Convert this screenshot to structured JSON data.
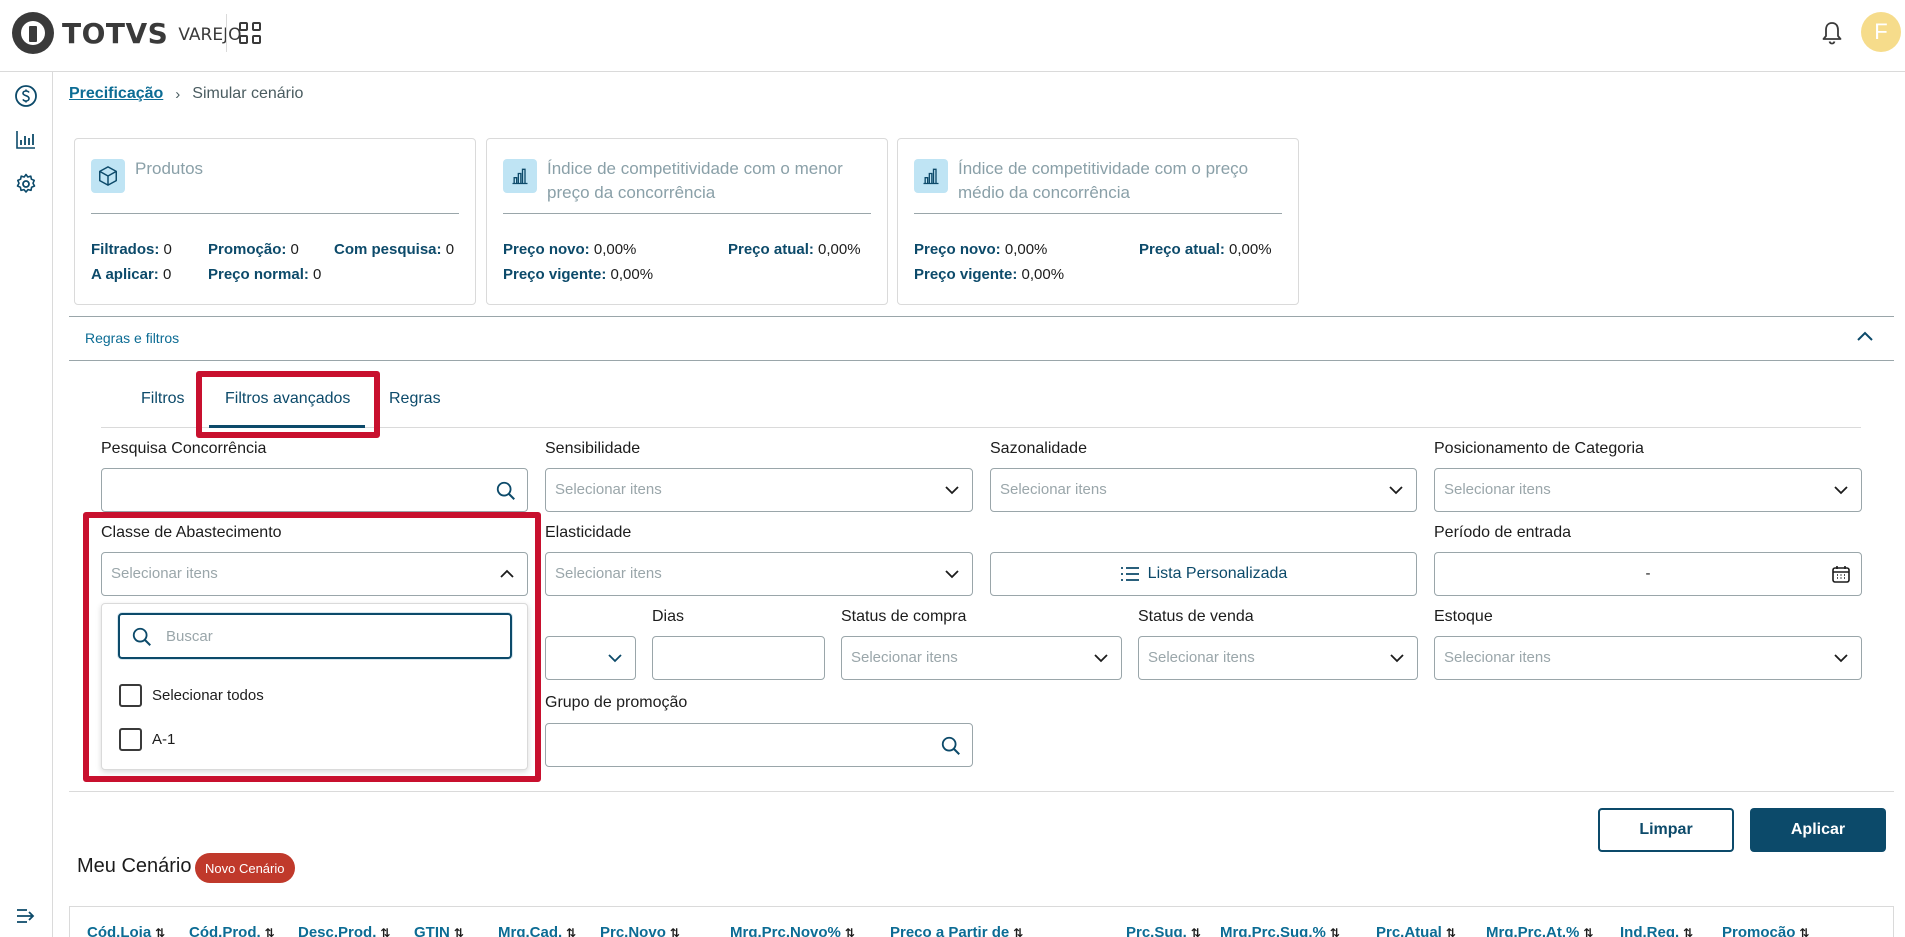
{
  "header": {
    "brand": "TOTVS",
    "brand_sub": "VAREJO",
    "user_initial": "F"
  },
  "breadcrumb": {
    "parent": "Precificação",
    "current": "Simular cenário"
  },
  "cards": [
    {
      "title": "Produtos",
      "lines": [
        {
          "label": "Filtrados:",
          "value": "0"
        },
        {
          "label": "Promoção:",
          "value": "0"
        },
        {
          "label": "Com pesquisa:",
          "value": "0"
        },
        {
          "label": "A aplicar:",
          "value": "0"
        },
        {
          "label": "Preço normal:",
          "value": "0"
        }
      ]
    },
    {
      "title": "Índice de competitividade com o menor preço da concorrência",
      "lines": [
        {
          "label": "Preço novo:",
          "value": "0,00%"
        },
        {
          "label": "Preço atual:",
          "value": "0,00%"
        },
        {
          "label": "Preço vigente:",
          "value": "0,00%"
        }
      ]
    },
    {
      "title": "Índice de competitividade com o preço médio da concorrência",
      "lines": [
        {
          "label": "Preço novo:",
          "value": "0,00%"
        },
        {
          "label": "Preço atual:",
          "value": "0,00%"
        },
        {
          "label": "Preço vigente:",
          "value": "0,00%"
        }
      ]
    }
  ],
  "section": {
    "label": "Regras e filtros"
  },
  "tabs": [
    "Filtros",
    "Filtros avançados",
    "Regras"
  ],
  "fields": {
    "pesquisa": {
      "label": "Pesquisa Concorrência"
    },
    "sensibilidade": {
      "label": "Sensibilidade",
      "placeholder": "Selecionar itens"
    },
    "sazonalidade": {
      "label": "Sazonalidade",
      "placeholder": "Selecionar itens"
    },
    "posicionamento": {
      "label": "Posicionamento de Categoria",
      "placeholder": "Selecionar itens"
    },
    "classe": {
      "label": "Classe de Abastecimento",
      "placeholder": "Selecionar itens"
    },
    "elasticidade": {
      "label": "Elasticidade",
      "placeholder": "Selecionar itens"
    },
    "lista": {
      "label": "Lista Personalizada"
    },
    "periodo": {
      "label": "Período de entrada",
      "value": "-"
    },
    "dias": {
      "label": "Dias"
    },
    "status_compra": {
      "label": "Status de compra",
      "placeholder": "Selecionar itens"
    },
    "status_venda": {
      "label": "Status de venda",
      "placeholder": "Selecionar itens"
    },
    "estoque": {
      "label": "Estoque",
      "placeholder": "Selecionar itens"
    },
    "grupo_promocao": {
      "label": "Grupo de promoção"
    }
  },
  "dropdown": {
    "search_placeholder": "Buscar",
    "options": [
      "Selecionar todos",
      "A-1"
    ]
  },
  "actions": {
    "clear": "Limpar",
    "apply": "Aplicar"
  },
  "scenario": {
    "title": "Meu Cenário",
    "badge": "Novo Cenário"
  },
  "table": {
    "columns": [
      "Cód.Loja",
      "Cód.Prod.",
      "Desc.Prod.",
      "GTIN",
      "Mrg.Cad.",
      "Prc.Novo",
      "Mrg.Prc.Novo%",
      "Preco a Partir de",
      "Prc.Sug.",
      "Mrg.Prc.Sug.%",
      "Prc.Atual",
      "Mrg.Prc.At.%",
      "Ind.Reg.",
      "Promoção"
    ]
  },
  "colors": {
    "primary": "#0c4a6a",
    "link": "#0c6c94",
    "highlight": "#c8102e",
    "badge": "#c0392b",
    "avatar": "#f6dc8b"
  }
}
